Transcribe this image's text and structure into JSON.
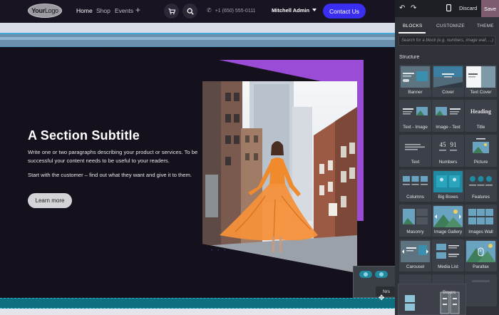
{
  "site": {
    "logo": {
      "part1": "Your",
      "part2": "Logo"
    },
    "nav": [
      {
        "label": "Home",
        "active": true
      },
      {
        "label": "Shop",
        "active": false
      },
      {
        "label": "Events",
        "active": false
      }
    ],
    "nav_plus": "+",
    "cart_icon": "cart-icon",
    "search_icon": "search-icon",
    "phone": "+1 (650) 555-0111",
    "user": "Mitchell Admin",
    "contact_button": "Contact Us",
    "accent_color": "#3a2ef0"
  },
  "hero": {
    "subtitle": "A Section Subtitle",
    "paragraph1": "Write one or two paragraphs describing your product or services. To be successful your content needs to be useful to your readers.",
    "paragraph2": "Start with the customer – find out what they want and give it to them.",
    "button": "Learn more",
    "shape_color": "#9b4cd6"
  },
  "drag": {
    "tooltip": "Nrs"
  },
  "editor": {
    "undo_icon": "undo-icon",
    "redo_icon": "redo-icon",
    "mobile_icon": "mobile-preview-icon",
    "discard": "Discard",
    "save": "Save",
    "tabs": [
      {
        "label": "BLOCKS",
        "active": true
      },
      {
        "label": "CUSTOMIZE",
        "active": false
      },
      {
        "label": "THEME",
        "active": false
      }
    ],
    "search_placeholder": "Search for a block (e.g. numbers, image wall, ...)",
    "section_title": "Structure",
    "blocks": [
      {
        "label": "Banner"
      },
      {
        "label": "Cover"
      },
      {
        "label": "Text Cover"
      },
      {
        "label": "Text - Image"
      },
      {
        "label": "Image - Text"
      },
      {
        "label": "Title"
      },
      {
        "label": "Text"
      },
      {
        "label": "Numbers"
      },
      {
        "label": "Picture"
      },
      {
        "label": "Columns"
      },
      {
        "label": "Big Boxes"
      },
      {
        "label": "Features"
      },
      {
        "label": "Masonry"
      },
      {
        "label": "Image Gallery"
      },
      {
        "label": "Images Wall"
      },
      {
        "label": "Carousel"
      },
      {
        "label": "Media List"
      },
      {
        "label": "Parallax"
      }
    ],
    "numbers_thumb": {
      "a": "45",
      "b": "91"
    },
    "title_thumb": "Heading",
    "extra_label": "Boxes"
  }
}
